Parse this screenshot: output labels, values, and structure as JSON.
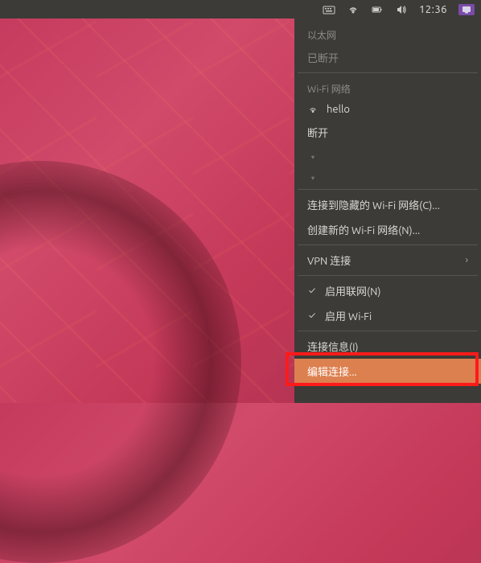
{
  "topbar": {
    "clock": "12:36"
  },
  "menu": {
    "ethernet_header": "以太网",
    "disconnected": "已断开",
    "wifi_header": "Wi-Fi 网络",
    "wifi_name": "hello",
    "disconnect": "断开",
    "connect_hidden": "连接到隐藏的 Wi-Fi 网络(C)...",
    "create_new": "创建新的 Wi-Fi 网络(N)...",
    "vpn": "VPN 连接",
    "enable_networking": "启用联网(N)",
    "enable_wifi": "启用 Wi-Fi",
    "connection_info": "连接信息(I)",
    "edit_connections": "编辑连接..."
  }
}
